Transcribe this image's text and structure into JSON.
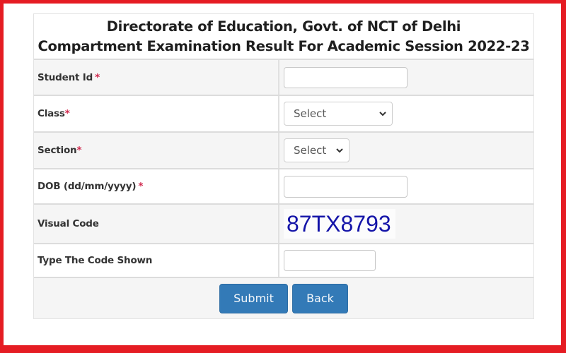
{
  "header": {
    "line1": "Directorate of Education, Govt. of NCT of Delhi",
    "line2": "Compartment Examination Result For Academic Session 2022-23"
  },
  "form": {
    "required_marker": "*",
    "fields": [
      {
        "label": "Student Id",
        "type": "text",
        "value": "",
        "placeholder": ""
      },
      {
        "label": "Class",
        "type": "select",
        "selected": "Select"
      },
      {
        "label": "Section",
        "type": "select",
        "selected": "Select"
      },
      {
        "label": "DOB (dd/mm/yyyy)",
        "type": "text",
        "value": "",
        "placeholder": ""
      },
      {
        "label": "Visual Code",
        "type": "captcha",
        "value": "87TX8793"
      },
      {
        "label": "Type The Code Shown",
        "type": "text",
        "value": "",
        "placeholder": ""
      }
    ]
  },
  "buttons": {
    "submit": "Submit",
    "back": "Back"
  },
  "colors": {
    "frame": "#e51c23",
    "button": "#337ab7",
    "captcha_text": "#1414a8",
    "required": "#d0284d"
  }
}
